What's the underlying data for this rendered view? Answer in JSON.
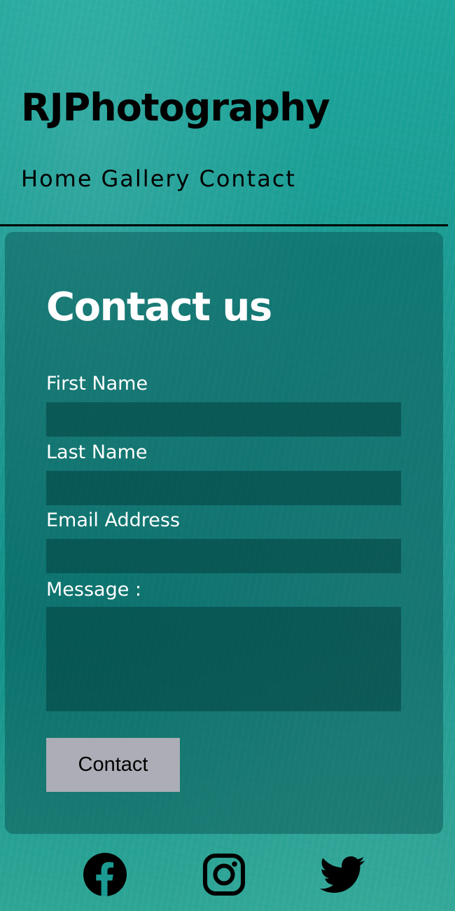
{
  "header": {
    "site_title": "RJPhotography",
    "nav": [
      {
        "label": "Home"
      },
      {
        "label": "Gallery"
      },
      {
        "label": "Contact"
      }
    ]
  },
  "contact_form": {
    "title": "Contact us",
    "fields": {
      "first_name": {
        "label": "First Name",
        "value": ""
      },
      "last_name": {
        "label": "Last Name",
        "value": ""
      },
      "email": {
        "label": "Email Address",
        "value": ""
      },
      "message": {
        "label": "Message :",
        "value": ""
      }
    },
    "submit_label": "Contact"
  },
  "social": [
    {
      "icon": "facebook-icon"
    },
    {
      "icon": "instagram-icon"
    },
    {
      "icon": "twitter-icon"
    }
  ],
  "colors": {
    "background": "#1a9a92",
    "card": "#054848",
    "button": "#acadb6",
    "text_light": "#ffffff",
    "text_dark": "#000000"
  }
}
